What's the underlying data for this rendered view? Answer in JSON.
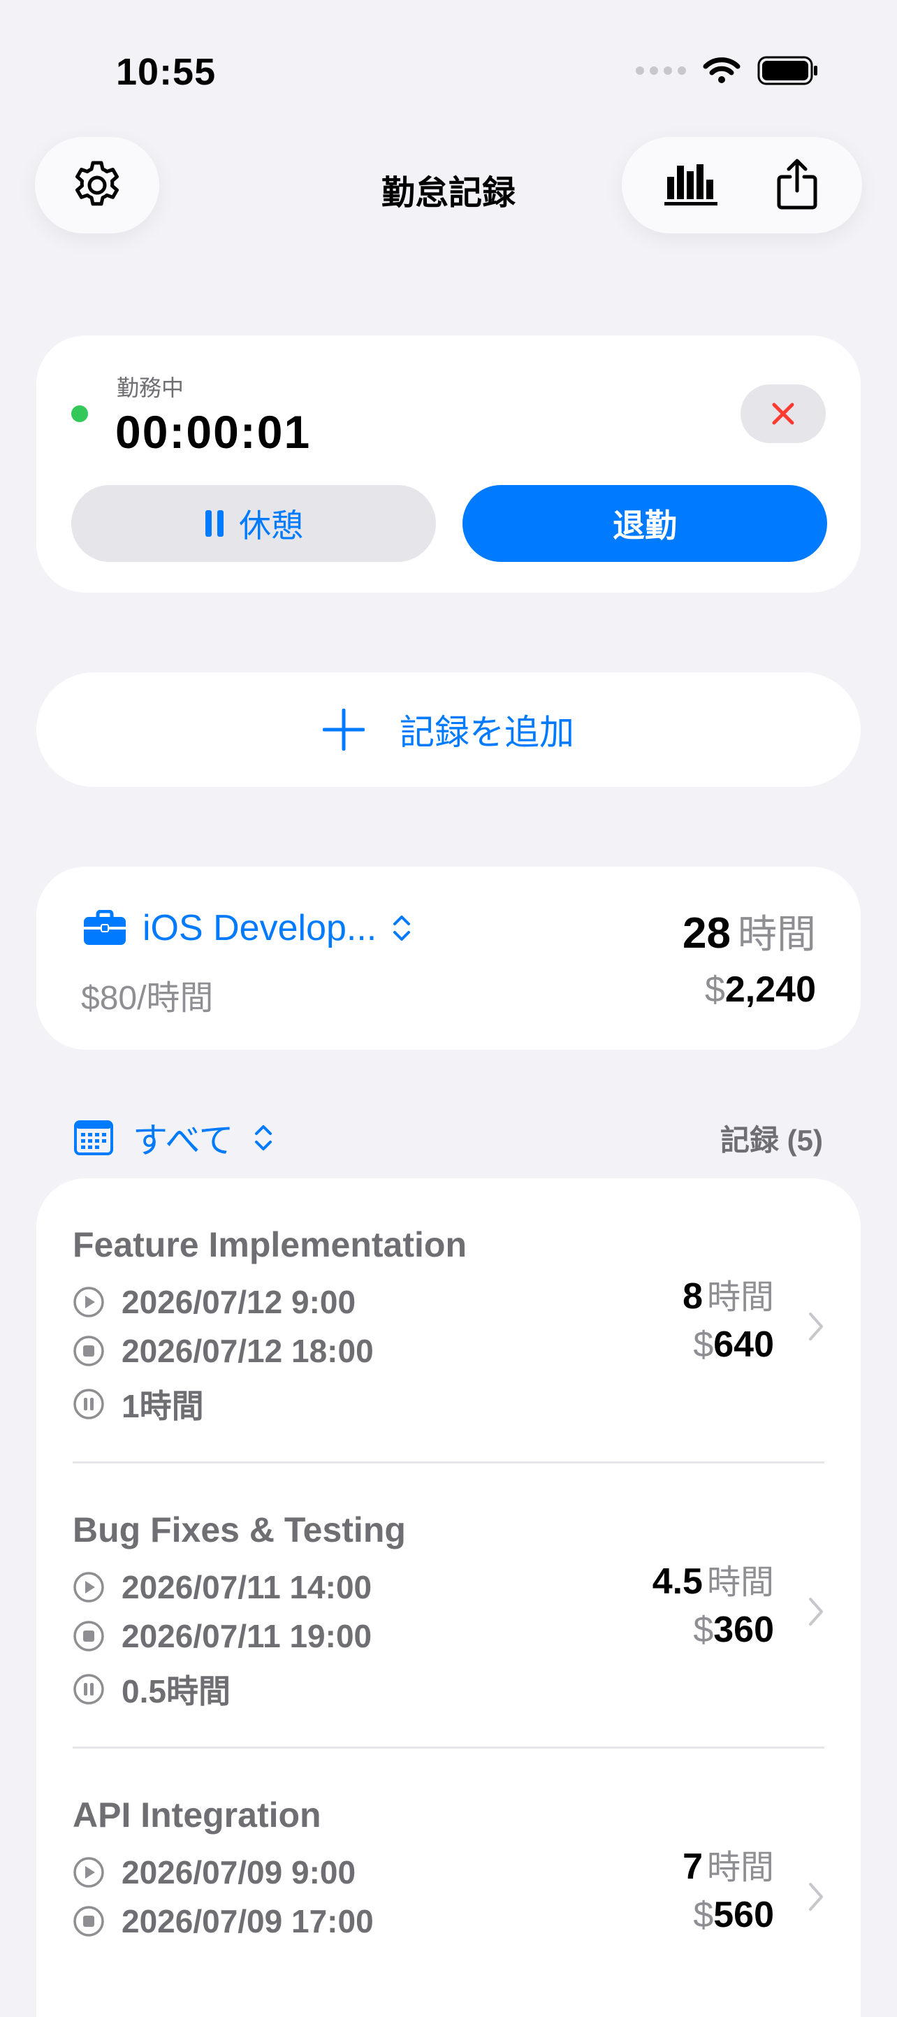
{
  "status_bar": {
    "time": "10:55"
  },
  "nav": {
    "title": "勤怠記録"
  },
  "timer": {
    "status": "勤務中",
    "elapsed": "00:00:01",
    "break_label": "休憩",
    "clock_out_label": "退勤"
  },
  "add_record_label": "記録を追加",
  "project": {
    "name": "iOS Develop...",
    "rate": "$80/時間",
    "hours": "28",
    "hours_unit": "時間",
    "currency": "$",
    "earnings": "2,240"
  },
  "filter": {
    "label": "すべて",
    "records_count": "記録 (5)"
  },
  "entries": [
    {
      "title": "Feature Implementation",
      "start": "2026/07/12 9:00",
      "end": "2026/07/12 18:00",
      "break": "1時間",
      "hours": "8",
      "hours_unit": "時間",
      "currency": "$",
      "earnings": "640"
    },
    {
      "title": "Bug Fixes & Testing",
      "start": "2026/07/11 14:00",
      "end": "2026/07/11 19:00",
      "break": "0.5時間",
      "hours": "4.5",
      "hours_unit": "時間",
      "currency": "$",
      "earnings": "360"
    },
    {
      "title": "API Integration",
      "start": "2026/07/09 9:00",
      "end": "2026/07/09 17:00",
      "hours": "7",
      "hours_unit": "時間",
      "currency": "$",
      "earnings": "560"
    }
  ],
  "colors": {
    "accent": "#007aff",
    "active": "#34c759",
    "danger": "#ff3b30",
    "background": "#f2f2f7"
  }
}
